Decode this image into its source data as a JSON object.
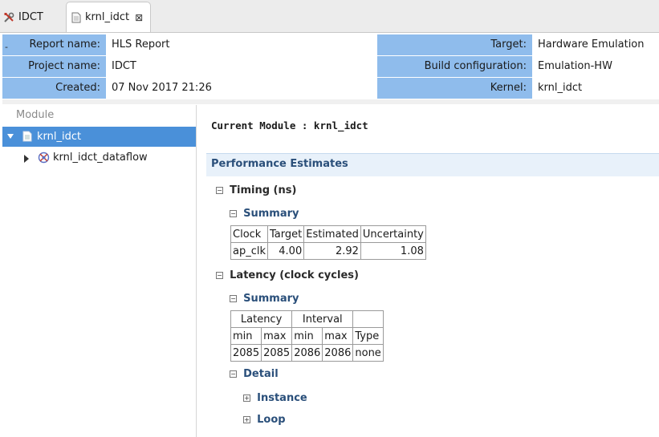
{
  "tabs": [
    {
      "label": "IDCT",
      "icon": "tools-icon"
    },
    {
      "label": "krnl_idct",
      "icon": "document-icon",
      "close": "⊠"
    }
  ],
  "header": {
    "collapse": "-",
    "left": [
      {
        "label": "Report name:",
        "value": "HLS Report"
      },
      {
        "label": "Project name:",
        "value": "IDCT"
      },
      {
        "label": "Created:",
        "value": "07 Nov 2017 21:26"
      }
    ],
    "right": [
      {
        "label": "Target:",
        "value": "Hardware Emulation"
      },
      {
        "label": "Build configuration:",
        "value": "Emulation-HW"
      },
      {
        "label": "Kernel:",
        "value": "krnl_idct"
      }
    ]
  },
  "tree": {
    "header": "Module",
    "items": [
      {
        "label": "krnl_idct",
        "icon": "document-icon",
        "expanded": true,
        "selected": true
      },
      {
        "label": "krnl_idct_dataflow",
        "icon": "dataflow-icon",
        "expanded": false,
        "selected": false
      }
    ]
  },
  "report": {
    "current_module": "Current Module : krnl_idct",
    "perf_title": "Performance Estimates",
    "timing": {
      "title": "Timing (ns)",
      "summary_title": "Summary",
      "headers": [
        "Clock",
        "Target",
        "Estimated",
        "Uncertainty"
      ],
      "row": [
        "ap_clk",
        "4.00",
        "2.92",
        "1.08"
      ]
    },
    "latency": {
      "title": "Latency (clock cycles)",
      "summary_title": "Summary",
      "group_headers": [
        "Latency",
        "Interval"
      ],
      "headers": [
        "min",
        "max",
        "min",
        "max",
        "Type"
      ],
      "row": [
        "2085",
        "2085",
        "2086",
        "2086",
        "none"
      ],
      "detail_title": "Detail",
      "instance_title": "Instance",
      "loop_title": "Loop"
    },
    "expand_glyph": "+",
    "collapse_glyph": "−"
  }
}
